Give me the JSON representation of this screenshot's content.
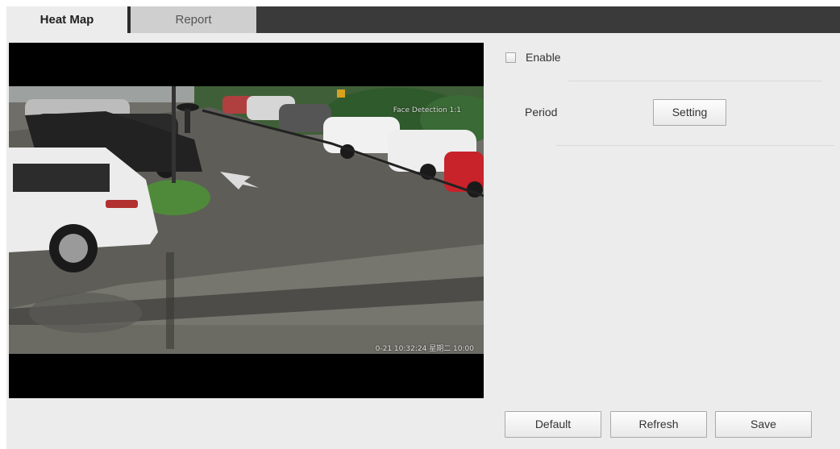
{
  "tabs": [
    {
      "label": "Heat Map",
      "active": true
    },
    {
      "label": "Report",
      "active": false
    }
  ],
  "video": {
    "osd_title": "Face Detection 1:1",
    "osd_timestamp": "0-21 10:32:24 星期二 10:00"
  },
  "settings": {
    "enable_label": "Enable",
    "enable_checked": false,
    "period_label": "Period",
    "setting_button": "Setting"
  },
  "actions": {
    "default_label": "Default",
    "refresh_label": "Refresh",
    "save_label": "Save"
  }
}
